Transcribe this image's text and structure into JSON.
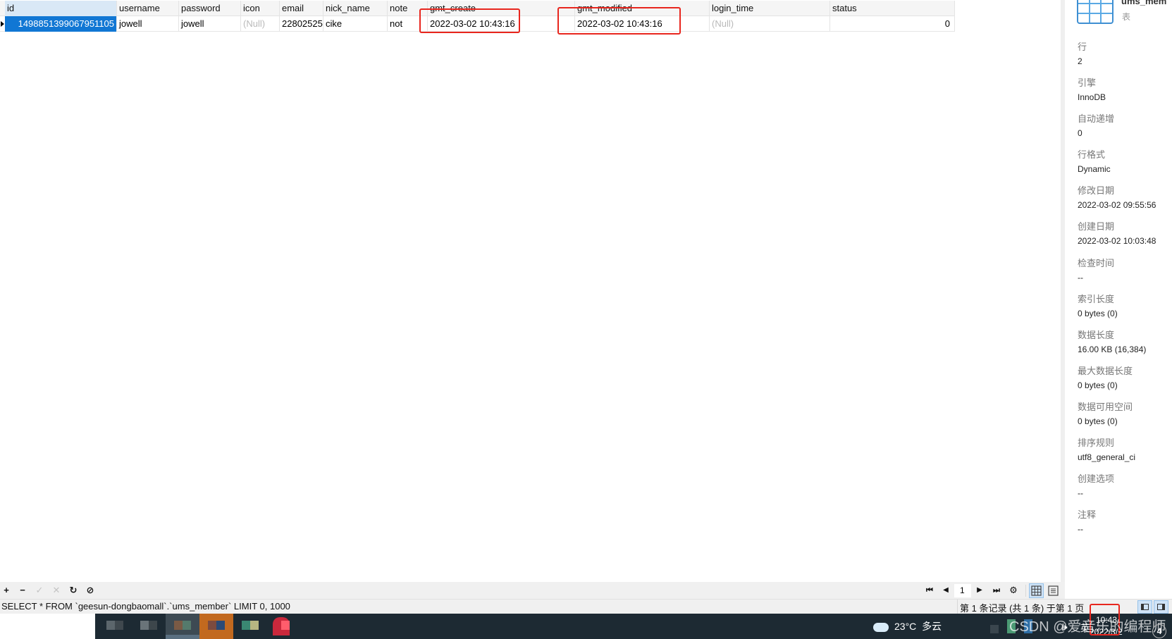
{
  "grid": {
    "columns": [
      "id",
      "username",
      "password",
      "icon",
      "email",
      "nick_name",
      "note",
      "gmt_create",
      "gmt_modified",
      "login_time",
      "status"
    ],
    "rows": [
      {
        "id": "1498851399067951105",
        "username": "jowell",
        "password": "jowell",
        "icon": "(Null)",
        "email": "22802525:",
        "nick_name": "cike",
        "note": "not",
        "gmt_create": "2022-03-02 10:43:16",
        "gmt_modified": "2022-03-02 10:43:16",
        "login_time": "(Null)",
        "status": "0"
      }
    ],
    "highlight_color": "#e8261e",
    "selection_color": "#1177d4"
  },
  "info_panel": {
    "title": "ums_mem",
    "subtitle": "表",
    "items": [
      {
        "label": "行",
        "value": "2"
      },
      {
        "label": "引擎",
        "value": "InnoDB"
      },
      {
        "label": "自动递增",
        "value": "0"
      },
      {
        "label": "行格式",
        "value": "Dynamic"
      },
      {
        "label": "修改日期",
        "value": "2022-03-02 09:55:56"
      },
      {
        "label": "创建日期",
        "value": "2022-03-02 10:03:48"
      },
      {
        "label": "检查时间",
        "value": "--"
      },
      {
        "label": "索引长度",
        "value": "0 bytes (0)"
      },
      {
        "label": "数据长度",
        "value": "16.00 KB (16,384)"
      },
      {
        "label": "最大数据长度",
        "value": "0 bytes (0)"
      },
      {
        "label": "数据可用空间",
        "value": "0 bytes (0)"
      },
      {
        "label": "排序规则",
        "value": "utf8_general_ci"
      },
      {
        "label": "创建选项",
        "value": "--"
      },
      {
        "label": "注释",
        "value": "--"
      }
    ]
  },
  "toolbar": {
    "add": "+",
    "delete": "−",
    "apply": "✓",
    "discard": "✕",
    "refresh": "↻",
    "stop": "⊘",
    "first": "⏮",
    "prev": "◀",
    "page": "1",
    "next": "▶",
    "last": "⏭",
    "settings": "⚙"
  },
  "statusbar": {
    "sql": "SELECT * FROM `geesun-dongbaomall`.`ums_member` LIMIT 0, 1000",
    "record_info": "第 1 条记录 (共 1 条) 于第 1 页"
  },
  "taskbar": {
    "weather_temp": "23°C",
    "weather_desc": "多云",
    "ime": "英",
    "clock_time": "10:43",
    "clock_date": "2022/3/2",
    "notifications": "4",
    "watermark": "CSDN @爱音乐的编程师"
  }
}
